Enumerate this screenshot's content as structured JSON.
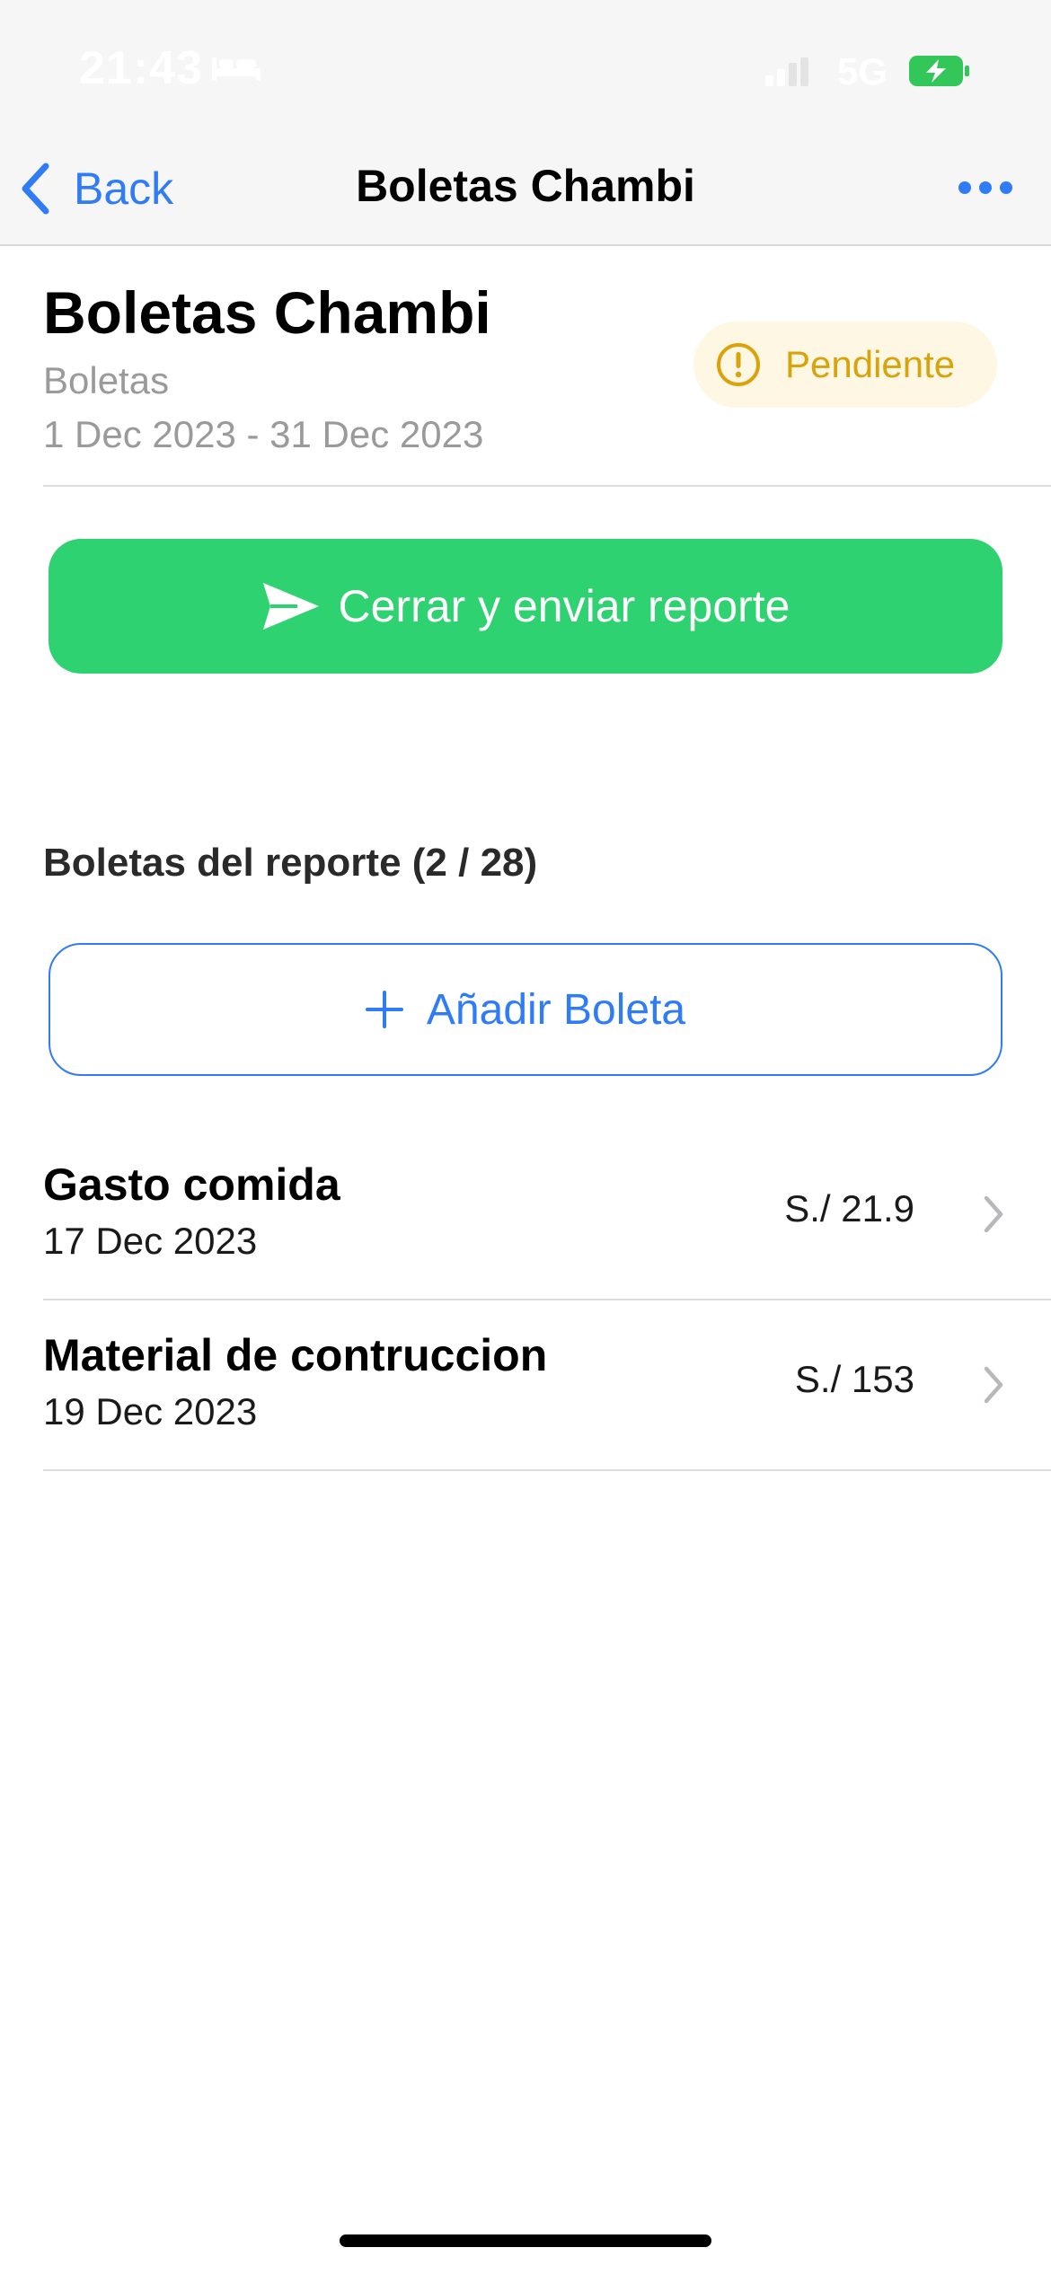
{
  "status_bar": {
    "time": "21:43",
    "network": "5G",
    "icons": [
      "bed-icon",
      "signal-icon",
      "battery-charging-icon"
    ]
  },
  "nav": {
    "back_label": "Back",
    "title": "Boletas Chambi",
    "icons": [
      "chevron-left-icon",
      "ellipsis-icon"
    ]
  },
  "report": {
    "title": "Boletas Chambi",
    "category": "Boletas",
    "date_range": "1 Dec 2023 - 31 Dec 2023",
    "status": "Pendiente",
    "status_icon": "exclamation-circle-icon"
  },
  "actions": {
    "send_label": "Cerrar y enviar reporte",
    "send_icon": "paper-plane-icon",
    "add_label": "Añadir Boleta",
    "add_icon": "plus-icon"
  },
  "section": {
    "title": "Boletas del reporte (2 / 28)"
  },
  "receipts": [
    {
      "title": "Gasto comida",
      "date": "17 Dec 2023",
      "amount": "S./ 21.9"
    },
    {
      "title": "Material de contruccion",
      "date": "19 Dec 2023",
      "amount": "S./ 153"
    }
  ],
  "colors": {
    "accent": "#2f7cf6",
    "success": "#2ed271",
    "warning": "#d9a30c",
    "warning_bg": "#fdf7e4",
    "secondary_text": "#9a9a9a"
  }
}
